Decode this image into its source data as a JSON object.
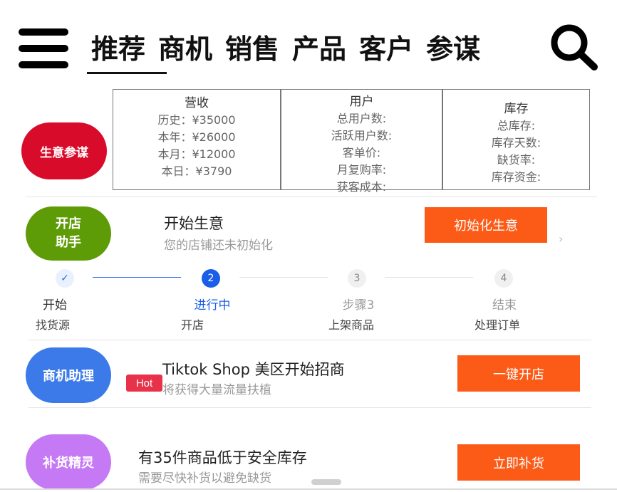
{
  "nav": {
    "tabs": [
      {
        "label": "推荐",
        "active": true
      },
      {
        "label": "商机"
      },
      {
        "label": "销售"
      },
      {
        "label": "产品"
      },
      {
        "label": "客户"
      },
      {
        "label": "参谋"
      }
    ]
  },
  "business_advisor": {
    "badge": "生意参谋",
    "revenue": {
      "title": "营收",
      "lines": [
        "历史：¥35000",
        "本年：¥26000",
        "本月：¥12000",
        "本日：¥3790"
      ]
    },
    "users": {
      "title": "用户",
      "lines": [
        "总用户数:",
        "活跃用户数:",
        "客单价:",
        "月复购率:",
        "获客成本:"
      ]
    },
    "inventory": {
      "title": "库存",
      "lines": [
        "总库存:",
        "库存天数:",
        "缺货率:",
        "库存资金:"
      ]
    }
  },
  "shop_assistant": {
    "badge_line1": "开店",
    "badge_line2": "助手",
    "title": "开始生意",
    "subtitle": "您的店铺还未初始化",
    "button": "初始化生意",
    "chevron": "›"
  },
  "stepper": {
    "steps": [
      {
        "marker": "✓",
        "label": "开始",
        "desc": "找货源",
        "state": "done"
      },
      {
        "marker": "2",
        "label": "进行中",
        "desc": "开店",
        "state": "active"
      },
      {
        "marker": "3",
        "label": "步骤3",
        "desc": "上架商品",
        "state": "todo"
      },
      {
        "marker": "4",
        "label": "结束",
        "desc": "处理订单",
        "state": "todo"
      }
    ]
  },
  "opportunity": {
    "badge": "商机助理",
    "hot": "Hot",
    "title": "Tiktok Shop 美区开始招商",
    "subtitle": "将获得大量流量扶植",
    "button": "一键开店"
  },
  "restock": {
    "badge": "补货精灵",
    "title": "有35件商品低于安全库存",
    "subtitle": "需要尽快补货以避免缺货",
    "button": "立即补货"
  },
  "colors": {
    "accent_orange": "#fb5b17",
    "badge_red": "#d90b2a",
    "badge_green": "#5e9c07",
    "badge_blue": "#3b7ae8",
    "badge_purple": "#c679f4",
    "step_active": "#1a5de8"
  },
  "icons": {
    "menu": "menu-icon",
    "search": "search-icon",
    "check": "check-icon",
    "chevron": "chevron-right-icon"
  }
}
